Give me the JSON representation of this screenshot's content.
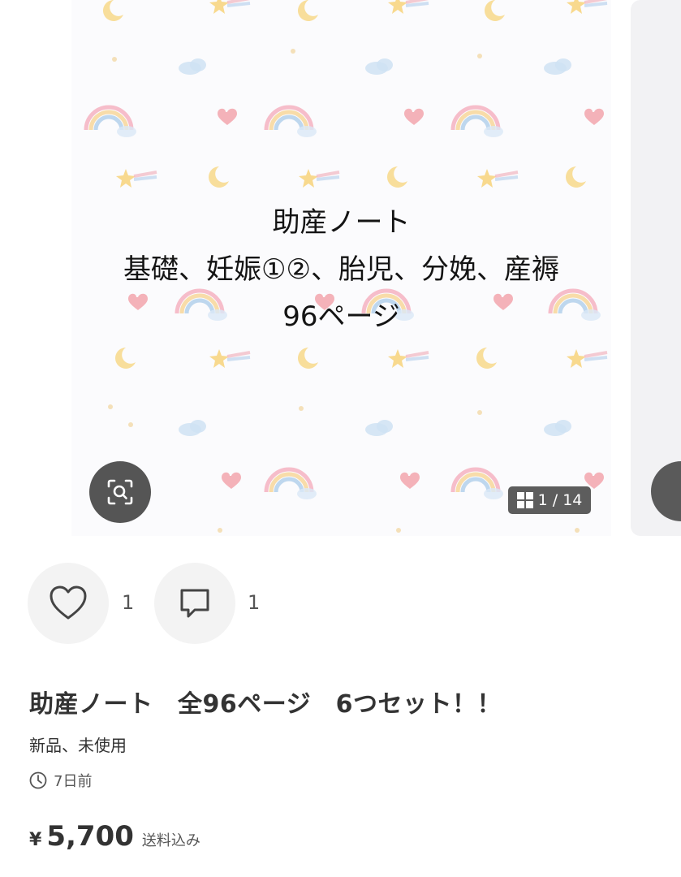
{
  "gallery": {
    "image_caption_lines": [
      "助産ノート",
      "基礎、妊娠①②、胎児、分娩、産褥",
      "96ページ"
    ],
    "counter": "1 / 14",
    "icons": {
      "lens": "image-search-icon",
      "grid": "grid-icon"
    }
  },
  "actions": {
    "like_count": "1",
    "comment_count": "1",
    "icons": {
      "like": "heart-icon",
      "comment": "comment-icon"
    }
  },
  "item": {
    "title": "助産ノート　全96ページ　6つセット！！",
    "condition": "新品、未使用",
    "posted": "7日前",
    "currency": "¥",
    "price": "5,700",
    "shipping": "送料込み"
  }
}
